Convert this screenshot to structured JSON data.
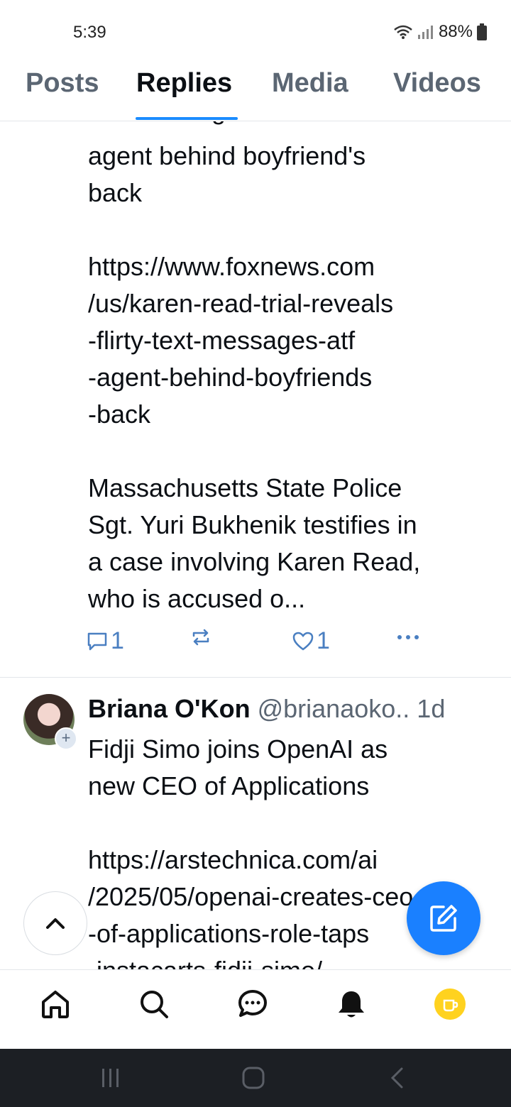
{
  "status_bar": {
    "time": "5:39",
    "battery": "88%",
    "icons": [
      "wifi-icon",
      "signal-icon",
      "battery-icon"
    ]
  },
  "tabs": [
    {
      "label": "Posts",
      "active": false
    },
    {
      "label": "Replies",
      "active": true
    },
    {
      "label": "Media",
      "active": false
    },
    {
      "label": "Videos",
      "active": false
    }
  ],
  "post1": {
    "text_partial_top": "text messages with ATF",
    "text": "agent behind boyfriend's\nback\n\nhttps://www.foxnews.com\n/us/karen-read-trial-reveals\n-flirty-text-messages-atf\n-agent-behind-boyfriends\n-back\n\nMassachusetts State Police\nSgt. Yuri Bukhenik testifies in\na case involving Karen Read,\nwho is accused o...",
    "reply_count": "1",
    "like_count": "1"
  },
  "post2": {
    "author_name": "Briana O'Kon",
    "author_handle": "@brianaoko..",
    "time_ago": "1d",
    "text": "Fidji Simo joins OpenAI as\nnew CEO of Applications\n\nhttps://arstechnica.com/ai\n/2025/05/openai-creates-ceo\n-of-applications-role-taps\n-instacarts-fidji-simo/"
  },
  "nav": [
    "home-icon",
    "search-icon",
    "chat-icon",
    "bell-icon",
    "coffee-icon"
  ],
  "colors": {
    "accent": "#1a80ff",
    "tab_active": "#0b0f14",
    "tab_inactive": "#5b6673",
    "action": "#4a7fc1",
    "coin": "#ffd21f"
  }
}
